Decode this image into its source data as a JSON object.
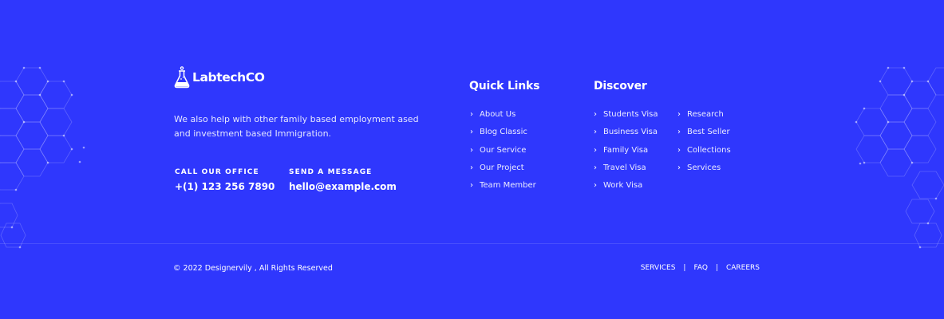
{
  "brand": {
    "name": "LabtechCO",
    "logo_icon": "flask-icon"
  },
  "about": {
    "text": "We also help with other family based employment ased and investment based Immigration."
  },
  "contact": {
    "office": {
      "label": "CALL OUR OFFICE",
      "value": "+(1) 123 256 7890"
    },
    "message": {
      "label": "SEND A MESSAGE",
      "value": "hello@example.com"
    }
  },
  "quick_links": {
    "title": "Quick Links",
    "items": [
      "About Us",
      "Blog Classic",
      "Our Service",
      "Our Project",
      "Team Member"
    ]
  },
  "discover": {
    "title": "Discover",
    "col1": [
      "Students Visa",
      "Business Visa",
      "Family Visa",
      "Travel Visa",
      "Work Visa"
    ],
    "col2": [
      "Research",
      "Best Seller",
      "Collections",
      "Services"
    ]
  },
  "footer": {
    "copyright": "© 2022 Designervily , All Rights Reserved",
    "links": [
      "SERVICES",
      "FAQ",
      "CAREERS"
    ],
    "separator": "|"
  },
  "colors": {
    "background": "#2f37fd",
    "text": "#ffffff",
    "muted": "#e4e6ff"
  }
}
